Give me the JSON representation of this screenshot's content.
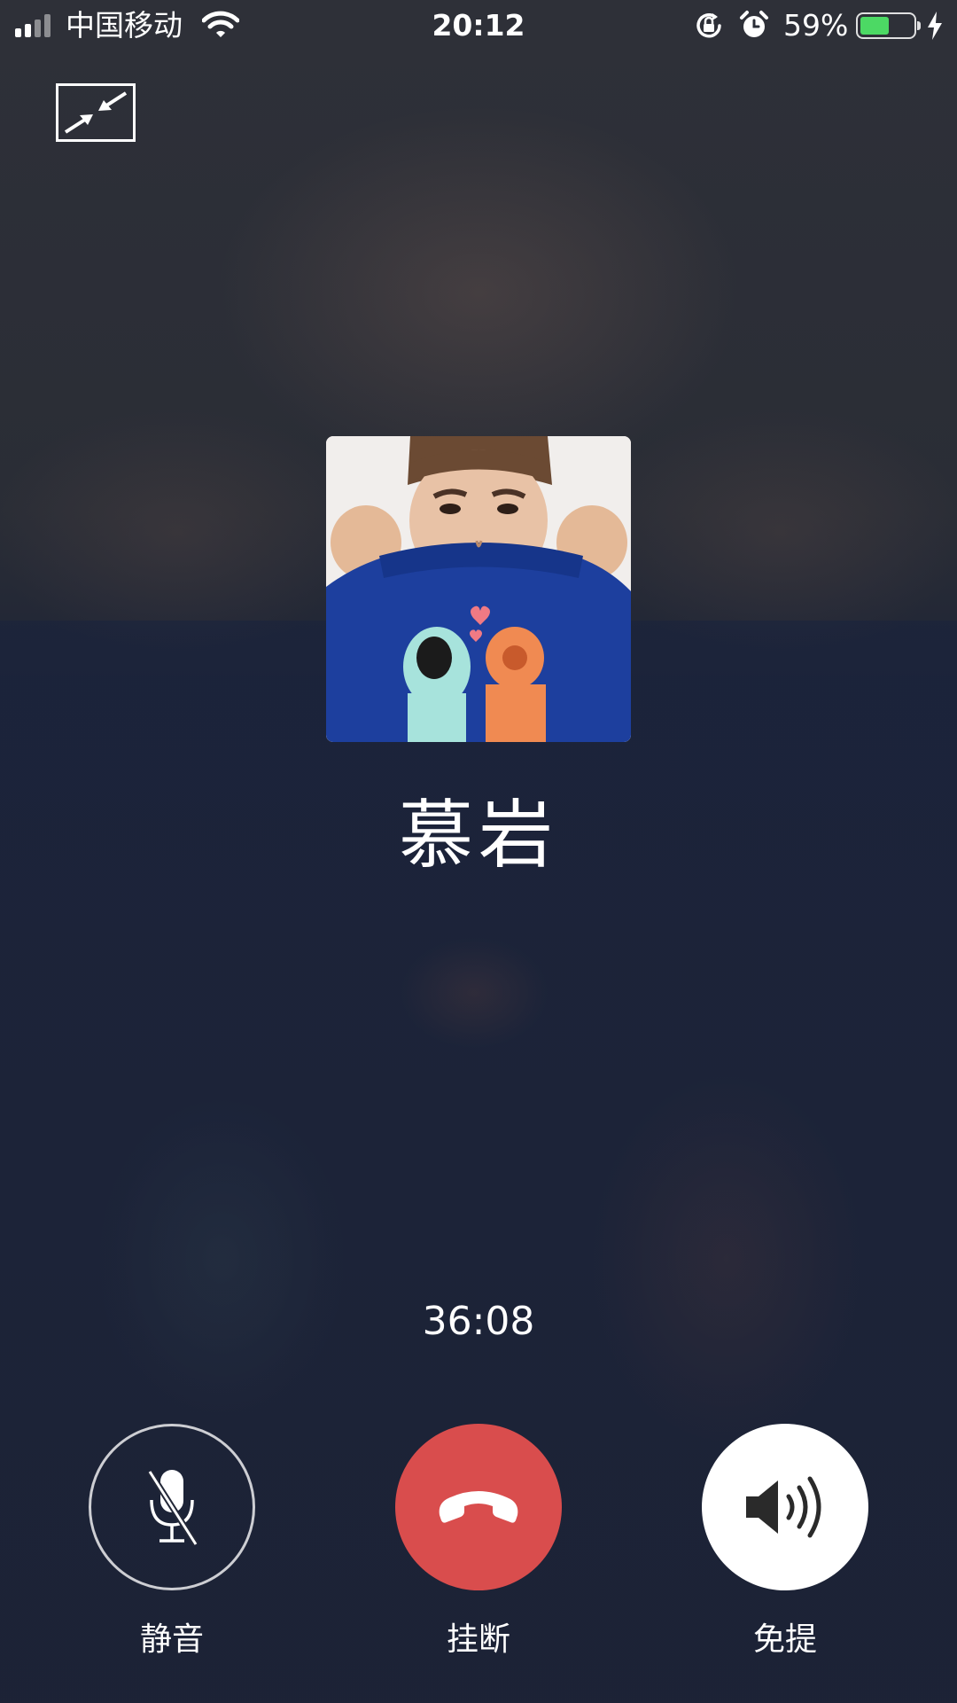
{
  "status_bar": {
    "carrier": "中国移动",
    "time": "20:12",
    "battery_percent": "59%",
    "battery_level": 0.59,
    "icons": [
      "signal-icon",
      "wifi-icon",
      "rotation-lock-icon",
      "alarm-icon",
      "battery-icon",
      "charging-icon"
    ]
  },
  "call": {
    "contact_name": "慕岩",
    "duration": "36:08"
  },
  "controls": {
    "mute_label": "静音",
    "hangup_label": "挂断",
    "speaker_label": "免提"
  },
  "colors": {
    "hangup": "#d94d4d",
    "battery_fill": "#4cd964",
    "text": "#ffffff"
  }
}
